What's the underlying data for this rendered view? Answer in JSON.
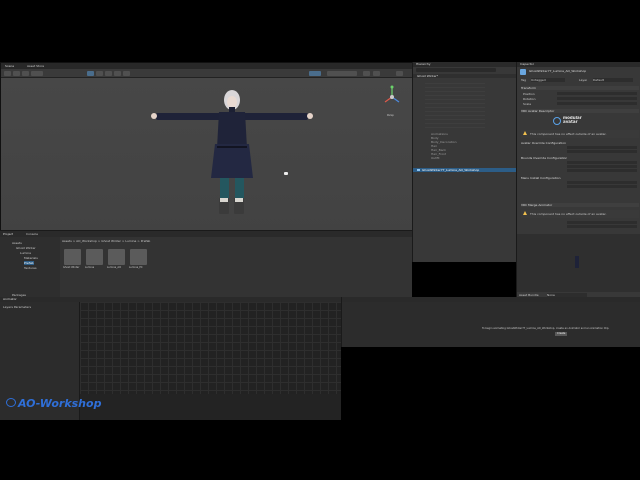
{
  "scene": {
    "tabs": [
      "Scene",
      "Asset Store"
    ],
    "view_mode": "Persp"
  },
  "hierarchy": {
    "tab": "Hierarchy",
    "root": "Ghost Winter*",
    "items": [
      "Animations",
      "Body",
      "Body_Decoration",
      "Hair",
      "Hair_Back",
      "Hair_Front",
      "Outfit"
    ],
    "selected": "GhostWinter77_Lumina_AO_Workshop"
  },
  "inspector": {
    "tab": "Inspector",
    "object_name": "GhostWinter77_Lumina_AO_Workshop",
    "tag_label": "Tag",
    "tag_value": "Untagged",
    "layer_label": "Layer",
    "layer_value": "Default",
    "transform_label": "Transform",
    "position_label": "Position",
    "rotation_label": "Rotation",
    "scale_label": "Scale",
    "component1": "VRC Avatar Descriptor",
    "logo_line1": "modular",
    "logo_line2": "avatar",
    "warning1": "This component has no effect outside of an avatar.",
    "section1": "Avatar Override Configuration",
    "section2": "Bounds Override Configuration",
    "section3": "Menu Install Configuration",
    "component2": "VRC Merge Animator",
    "warning2": "This component has no effect outside of an avatar.",
    "footer_label": "Asset Bundle",
    "footer_value": "None"
  },
  "project": {
    "tabs": [
      "Project",
      "Console"
    ],
    "breadcrumb": "Assets > AO_Workshop > Ghost Winter > Lumina > Prefab",
    "tree": [
      "Assets",
      "Ghost Winter",
      "Lumina",
      "Materials",
      "Prefab",
      "Textures",
      "Packages"
    ],
    "assets": [
      "Ghost Winter",
      "Lumina",
      "Lumina_AO",
      "Lumina_PC"
    ]
  },
  "animator": {
    "tab": "Animator",
    "side_label": "Layers Parameters"
  },
  "console": {
    "message": "To begin animating GhostWinter77_Lumina_AO_Workshop, create an Animator and an Animation Clip.",
    "button": "Create"
  },
  "watermark": {
    "text": "AO-Workshop",
    "color": "#2f6fd8"
  },
  "colors": {
    "selection": "#2c5d87",
    "scene_bg": "#464646"
  }
}
